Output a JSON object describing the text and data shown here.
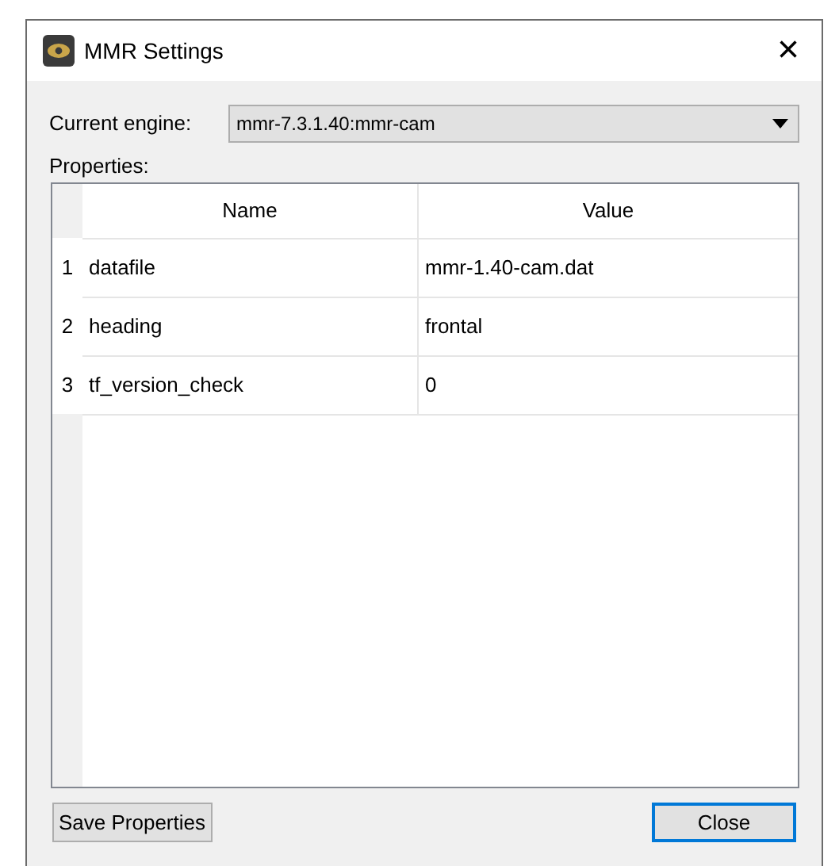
{
  "window": {
    "title": "MMR Settings",
    "close": "×"
  },
  "engine": {
    "label": "Current engine:",
    "value": "mmr-7.3.1.40:mmr-cam"
  },
  "properties_label": "Properties:",
  "table": {
    "columns": [
      "Name",
      "Value"
    ],
    "rows": [
      {
        "index": "1",
        "name": "datafile",
        "value": "mmr-1.40-cam.dat"
      },
      {
        "index": "2",
        "name": "heading",
        "value": "frontal"
      },
      {
        "index": "3",
        "name": "tf_version_check",
        "value": "0"
      }
    ]
  },
  "buttons": [
    {
      "label": "Save Properties",
      "default": false
    },
    {
      "label": "Close",
      "default": true
    }
  ]
}
